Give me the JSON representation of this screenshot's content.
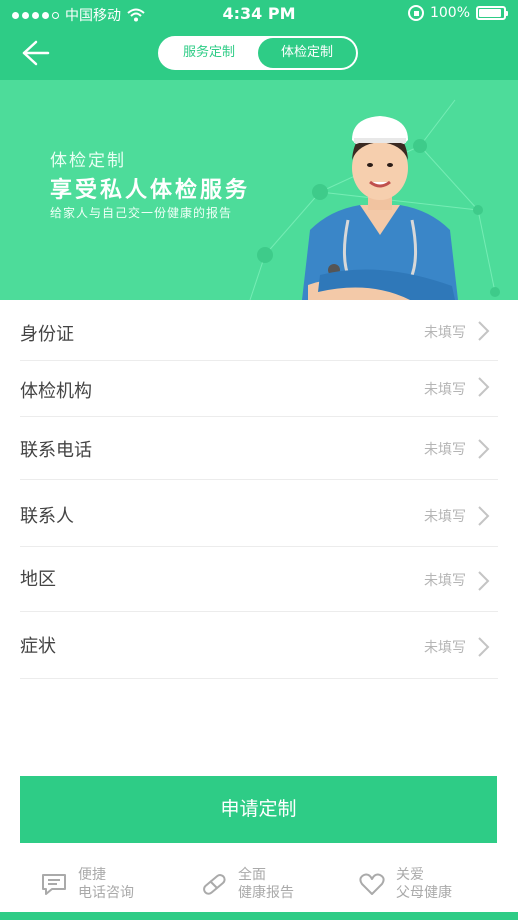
{
  "status_bar": {
    "carrier": "中国移动",
    "time": "4:34 PM",
    "battery": "100%"
  },
  "header": {
    "tabs": [
      {
        "label": "服务定制",
        "active": false
      },
      {
        "label": "体检定制",
        "active": true
      }
    ]
  },
  "banner": {
    "subtitle": "体检定制",
    "title": "享受私人体检服务",
    "description": "给家人与自己交一份健康的报告"
  },
  "form": {
    "rows": [
      {
        "label": "身份证",
        "value": "未填写"
      },
      {
        "label": "体检机构",
        "value": "未填写"
      },
      {
        "label": "联系电话",
        "value": "未填写"
      },
      {
        "label": "联系人",
        "value": "未填写"
      },
      {
        "label": "地区",
        "value": "未填写"
      },
      {
        "label": "症状",
        "value": "未填写"
      }
    ]
  },
  "submit_label": "申请定制",
  "features": [
    {
      "line1": "便捷",
      "line2": "电话咨询",
      "icon": "chat-icon"
    },
    {
      "line1": "全面",
      "line2": "健康报告",
      "icon": "pill-icon"
    },
    {
      "line1": "关爱",
      "line2": "父母健康",
      "icon": "heart-icon"
    }
  ],
  "colors": {
    "primary": "#2ecc86",
    "banner": "#4ddc9a",
    "placeholder": "#b5b5b5"
  }
}
